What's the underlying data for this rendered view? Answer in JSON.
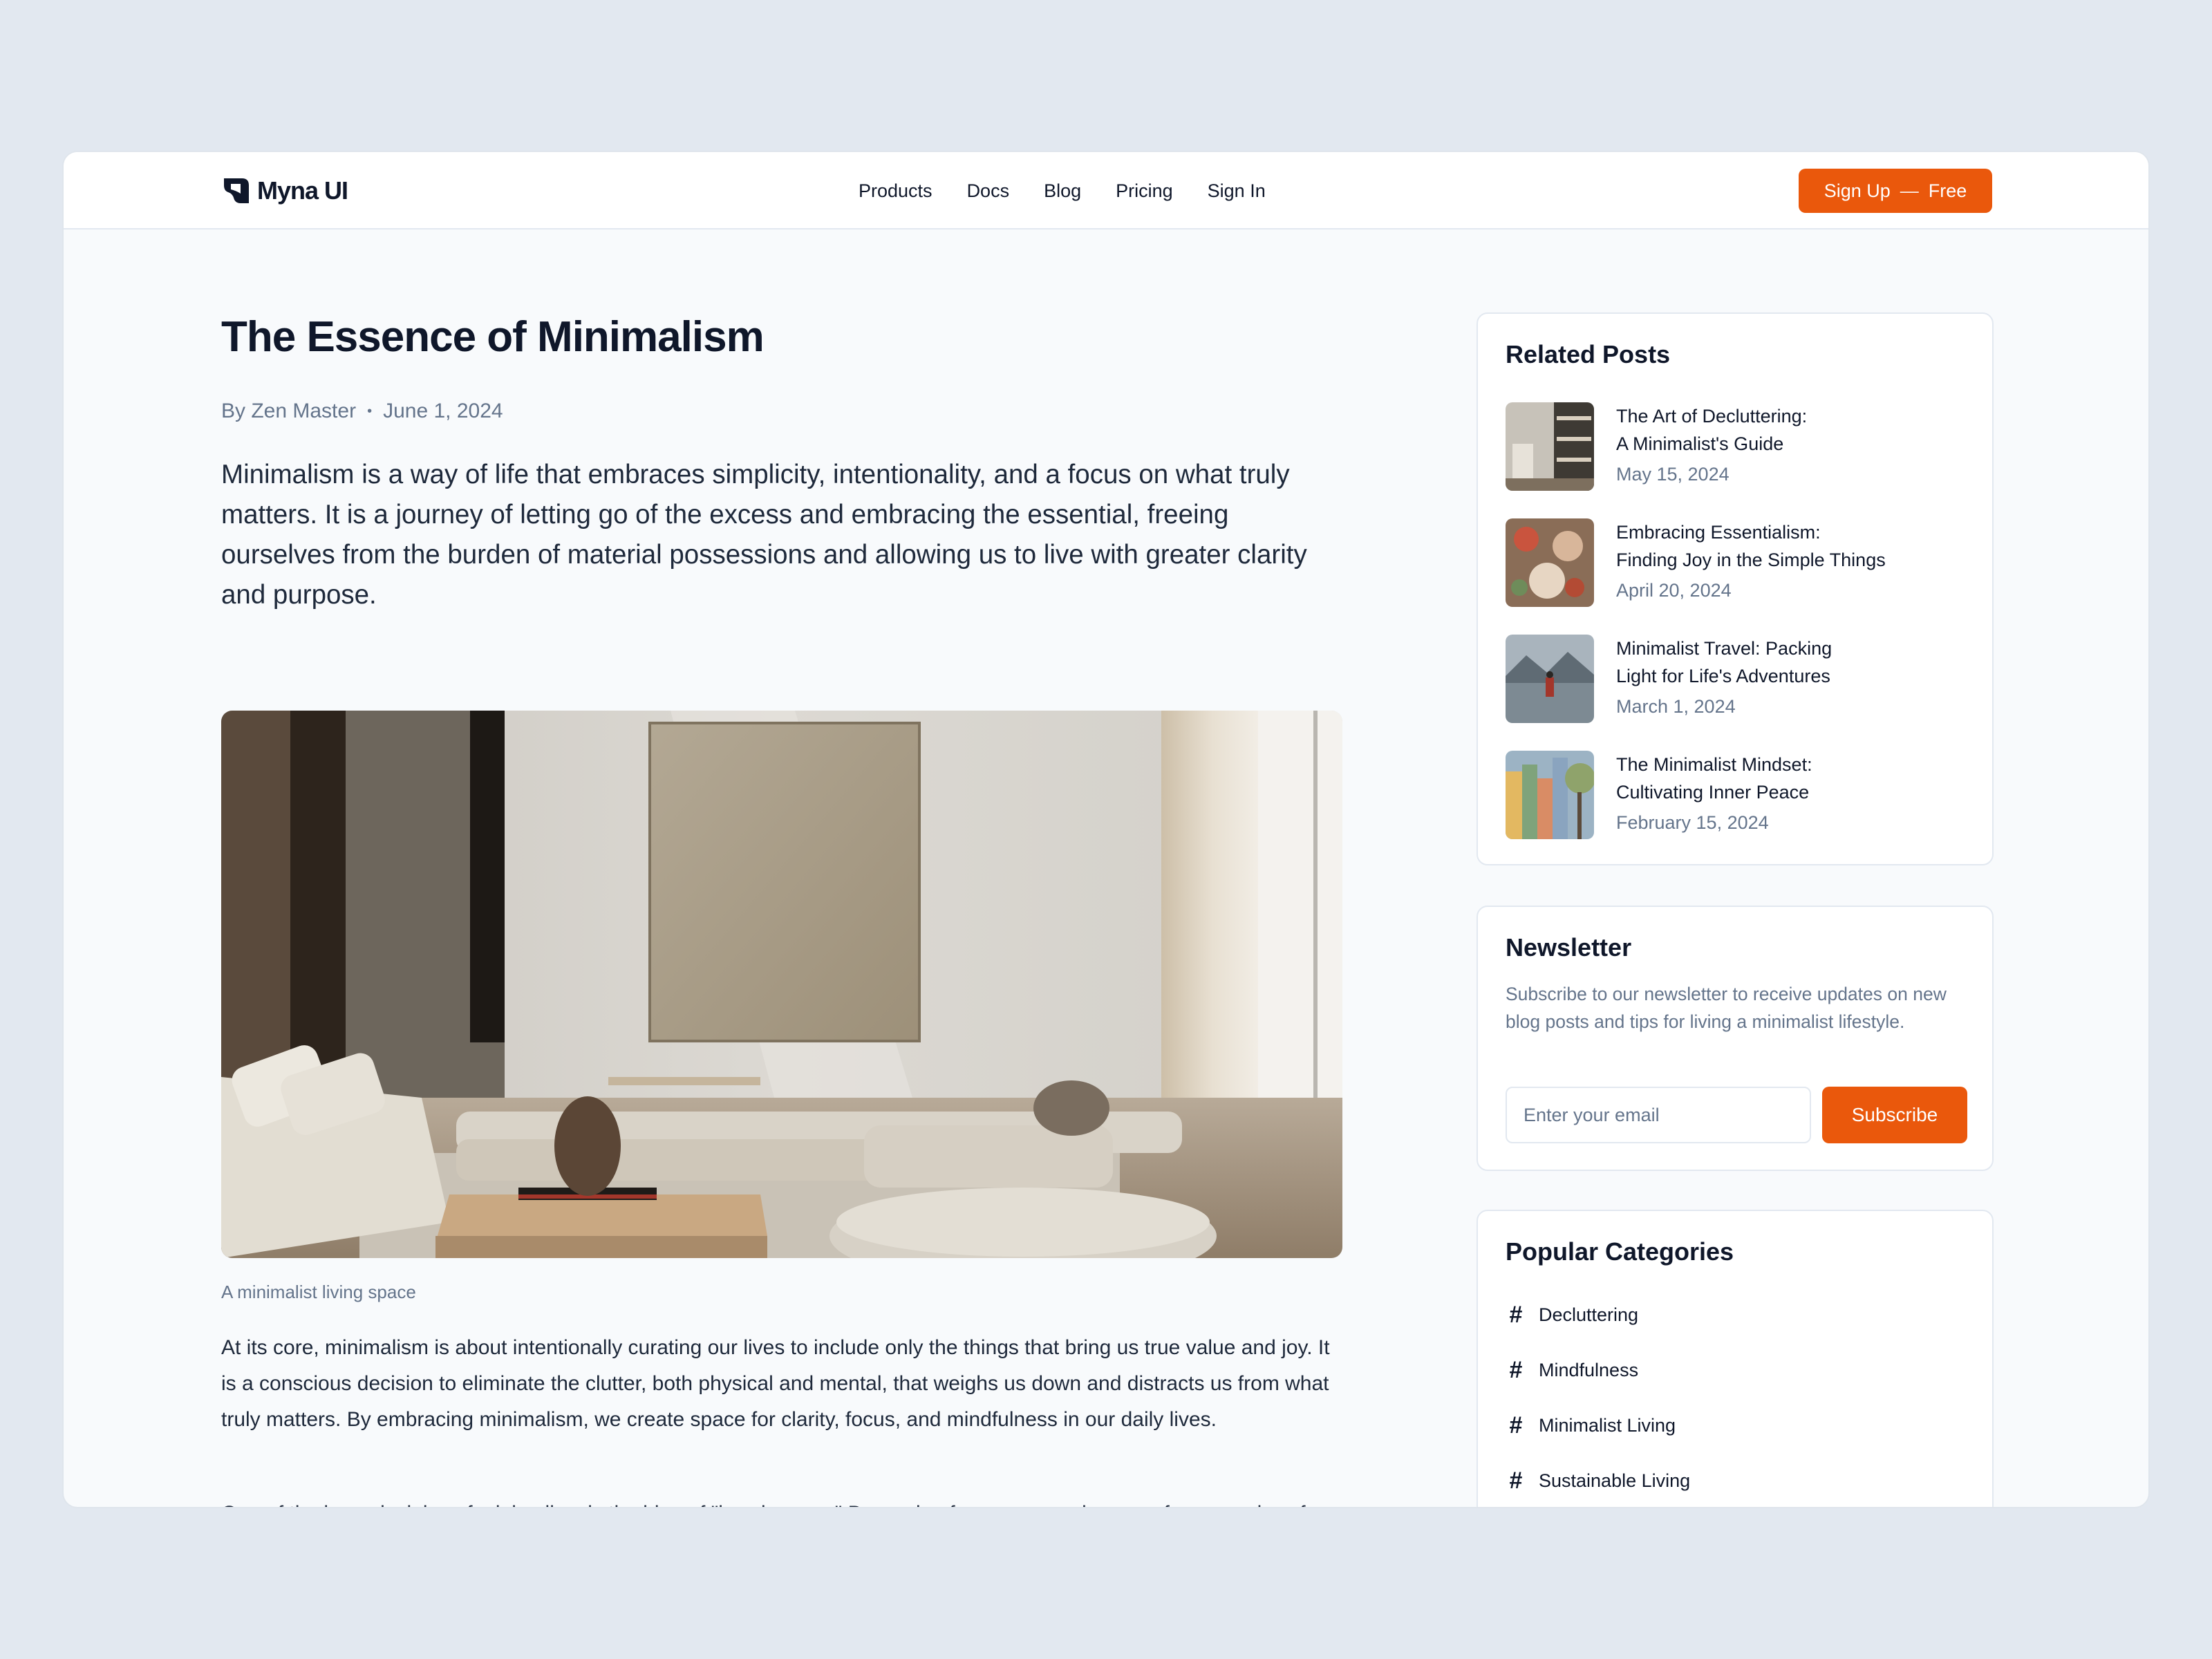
{
  "colors": {
    "accent": "#ea580c",
    "text": "#0f172a",
    "muted": "#64748b",
    "page": "#e2e8f0"
  },
  "header": {
    "logo_text": "Myna UI",
    "logo_icon": "myna-logo-icon",
    "nav": [
      "Products",
      "Docs",
      "Blog",
      "Pricing",
      "Sign In"
    ],
    "signup_label": "Sign Up",
    "signup_sep": "—",
    "signup_suffix": "Free"
  },
  "article": {
    "title": "The Essence of Minimalism",
    "author": "By Zen Master",
    "meta_sep": "•",
    "date": "June 1, 2024",
    "lead": "Minimalism is a way of life that embraces simplicity, intentionality, and a focus on what truly matters. It is a journey of letting go of the excess and embracing the essential, freeing ourselves from the burden of material possessions and allowing us to live with greater clarity and purpose.",
    "caption": "A minimalist living space",
    "paragraphs": [
      "At its core, minimalism is about intentionally curating our lives to include only the things that bring us true value and joy. It is a conscious decision to eliminate the clutter, both physical and mental, that weighs us down and distracts us from what truly matters. By embracing minimalism, we create space for clarity, focus, and mindfulness in our daily lives.",
      "One of the key principles of minimalism is the idea of \"less is more.\" By owning fewer possessions, we free ourselves from the burden of maintaining, organizing, and storing excess. This liberation allows us to redirect our time, energy, and resources towards experiences, relationships, and pursuits that truly enrich our lives."
    ]
  },
  "related": {
    "title": "Related Posts",
    "posts": [
      {
        "title_1": "The Art of Decluttering:",
        "title_2": "A Minimalist's Guide",
        "date": "May 15, 2024"
      },
      {
        "title_1": "Embracing Essentialism:",
        "title_2": "Finding Joy in the Simple Things",
        "date": "April 20, 2024"
      },
      {
        "title_1": "Minimalist Travel: Packing",
        "title_2": "Light for Life's Adventures",
        "date": "March 1, 2024"
      },
      {
        "title_1": "The Minimalist Mindset:",
        "title_2": "Cultivating Inner Peace",
        "date": "February 15, 2024"
      }
    ]
  },
  "newsletter": {
    "title": "Newsletter",
    "description": "Subscribe to our newsletter to receive updates on new blog posts and tips for living a minimalist lifestyle.",
    "placeholder": "Enter your email",
    "button": "Subscribe"
  },
  "categories": {
    "title": "Popular Categories",
    "hash": "#",
    "items": [
      "Decluttering",
      "Mindfulness",
      "Minimalist Living",
      "Sustainable Living"
    ]
  }
}
